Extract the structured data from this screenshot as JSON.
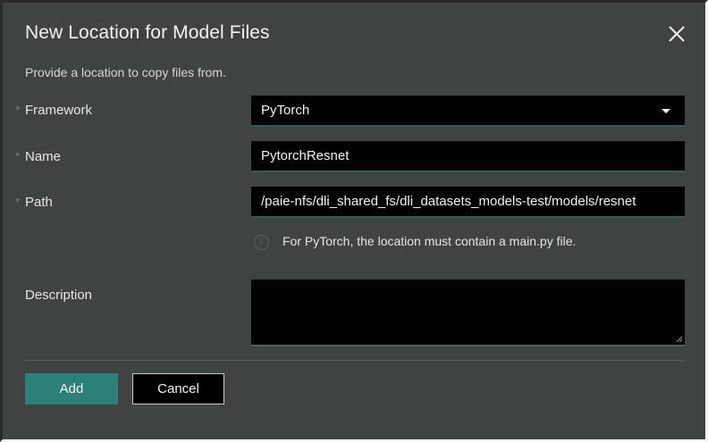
{
  "dialog": {
    "title": "New Location for Model Files",
    "subtitle": "Provide a location to copy files from.",
    "close_icon": "close-icon"
  },
  "form": {
    "required_mark": "*",
    "framework": {
      "label": "Framework",
      "value": "PyTorch"
    },
    "name": {
      "label": "Name",
      "value": "PytorchResnet"
    },
    "path": {
      "label": "Path",
      "value": "/paie-nfs/dli_shared_fs/dli_datasets_models-test/models/resnet"
    },
    "hint": {
      "icon": "info-icon",
      "icon_glyph": "i",
      "text": "For PyTorch, the location must contain a main.py file."
    },
    "description": {
      "label": "Description",
      "value": ""
    }
  },
  "actions": {
    "add_label": "Add",
    "cancel_label": "Cancel"
  },
  "colors": {
    "dialog_bg": "#3f4342",
    "field_bg": "#000000",
    "accent": "#2d8077"
  }
}
